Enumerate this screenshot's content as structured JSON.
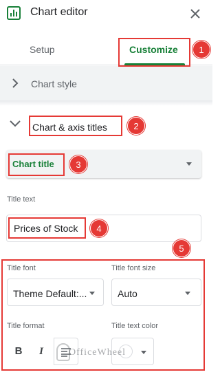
{
  "header": {
    "title": "Chart editor",
    "icon": "chart-icon",
    "close_icon": "close-icon"
  },
  "tabs": [
    {
      "label": "Setup"
    },
    {
      "label": "Customize",
      "active": true
    }
  ],
  "sections": {
    "chart_style": {
      "label": "Chart style",
      "expanded": false
    },
    "chart_axis_titles": {
      "label": "Chart & axis titles",
      "expanded": true
    }
  },
  "title_select": {
    "value": "Chart title"
  },
  "title_text": {
    "label": "Title text",
    "value": "Prices of Stock"
  },
  "title_font": {
    "label": "Title font",
    "value": "Theme Default:..."
  },
  "title_font_size": {
    "label": "Title font size",
    "value": "Auto"
  },
  "title_format": {
    "label": "Title format",
    "bold": "B",
    "italic": "I",
    "align_icon": "align-left-icon"
  },
  "title_text_color": {
    "label": "Title text color",
    "value_color": "#ffffff"
  },
  "annotations": {
    "n1": "1",
    "n2": "2",
    "n3": "3",
    "n4": "4",
    "n5": "5"
  },
  "watermark": {
    "text": "OfficeWheel"
  },
  "colors": {
    "accent": "#188038",
    "annotation": "#e53935",
    "panel": "#f1f3f4"
  }
}
